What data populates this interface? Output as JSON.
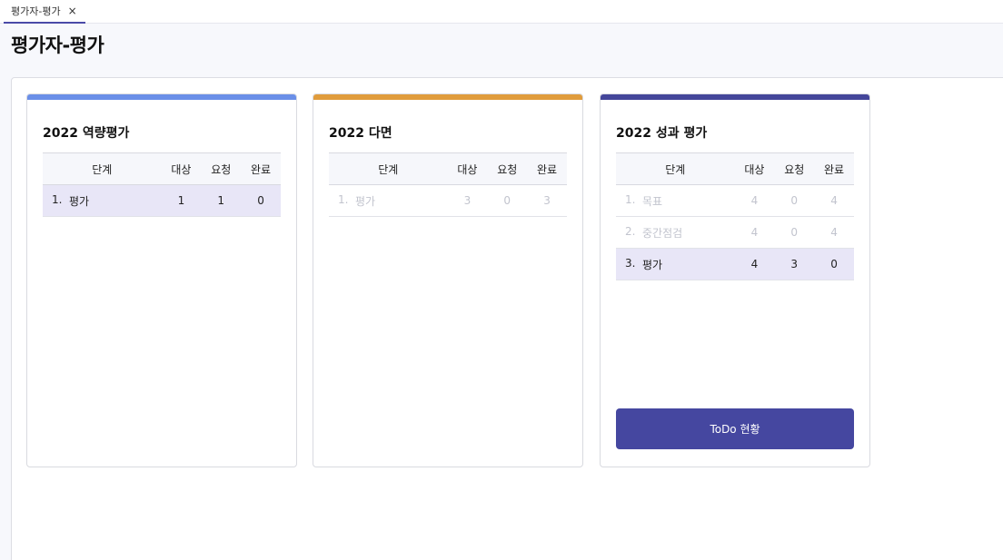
{
  "tab": {
    "label": "평가자-평가",
    "close": "×"
  },
  "page_title": "평가자-평가",
  "colors": {
    "card1": "#6a8fe8",
    "card2": "#e09c3c",
    "card3": "#44469a",
    "button": "#4547a0"
  },
  "table_headers": {
    "stage": "단계",
    "target": "대상",
    "request": "요청",
    "done": "완료"
  },
  "cards": [
    {
      "title": "2022 역량평가",
      "rows": [
        {
          "num": "1.",
          "name": "평가",
          "target": "1",
          "request": "1",
          "done": "0",
          "state": "active"
        }
      ]
    },
    {
      "title": "2022 다면",
      "rows": [
        {
          "num": "1.",
          "name": "평가",
          "target": "3",
          "request": "0",
          "done": "3",
          "state": "dim"
        }
      ]
    },
    {
      "title": "2022 성과 평가",
      "rows": [
        {
          "num": "1.",
          "name": "목표",
          "target": "4",
          "request": "0",
          "done": "4",
          "state": "dim"
        },
        {
          "num": "2.",
          "name": "중간점검",
          "target": "4",
          "request": "0",
          "done": "4",
          "state": "dim"
        },
        {
          "num": "3.",
          "name": "평가",
          "target": "4",
          "request": "3",
          "done": "0",
          "state": "active"
        }
      ],
      "button_label": "ToDo 현황"
    }
  ]
}
